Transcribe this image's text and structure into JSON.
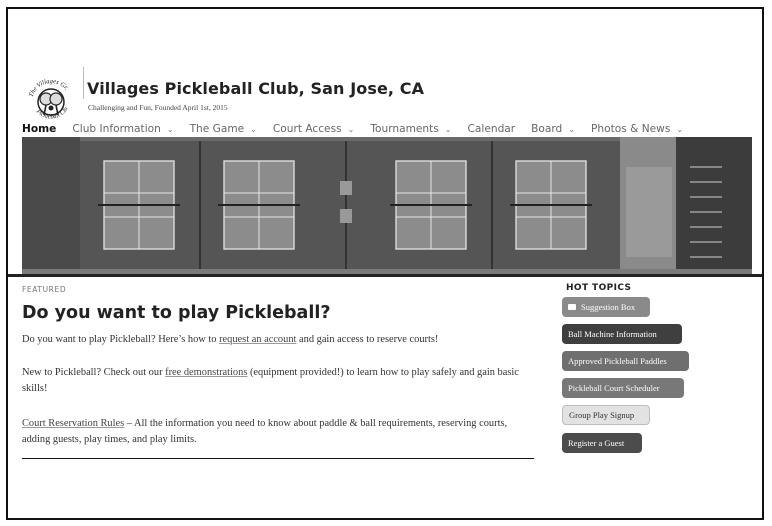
{
  "site": {
    "title": "Villages Pickleball Club, San Jose, CA",
    "tagline": "Challenging and Fun, Founded April 1st, 2015",
    "logo_icon": "pickleball-club-logo"
  },
  "nav": {
    "items": [
      {
        "label": "Home",
        "dropdown": false
      },
      {
        "label": "Club Information",
        "dropdown": true
      },
      {
        "label": "The Game",
        "dropdown": true
      },
      {
        "label": "Court Access",
        "dropdown": true
      },
      {
        "label": "Tournaments",
        "dropdown": true
      },
      {
        "label": "Calendar",
        "dropdown": false
      },
      {
        "label": "Board",
        "dropdown": true
      },
      {
        "label": "Photos & News",
        "dropdown": true
      }
    ]
  },
  "post": {
    "category": "FEATURED",
    "title": "Do you want to play Pickleball?",
    "p1_before": "Do you want to play Pickleball? Here’s how to ",
    "p1_link": "request an account",
    "p1_after": " and gain access to reserve courts!",
    "p2_before": "New to Pickleball? Check out our ",
    "p2_link": "free demonstrations",
    "p2_after": " (equipment provided!) to learn how to play safely and gain basic skills!",
    "p3_link": "Court Reservation Rules",
    "p3_after": "  – All the information you need to know about paddle & ball requirements, reserving courts, adding guests, play times, and play limits."
  },
  "sidebar": {
    "heading": "HOT TOPICS",
    "buttons": [
      {
        "label": "Suggestion Box",
        "icon": "envelope-icon"
      },
      {
        "label": "Ball Machine Information"
      },
      {
        "label": "Approved Pickleball Paddles"
      },
      {
        "label": "Pickleball Court Scheduler"
      },
      {
        "label": "Group Play Signup"
      },
      {
        "label": "Register a Guest"
      }
    ]
  }
}
